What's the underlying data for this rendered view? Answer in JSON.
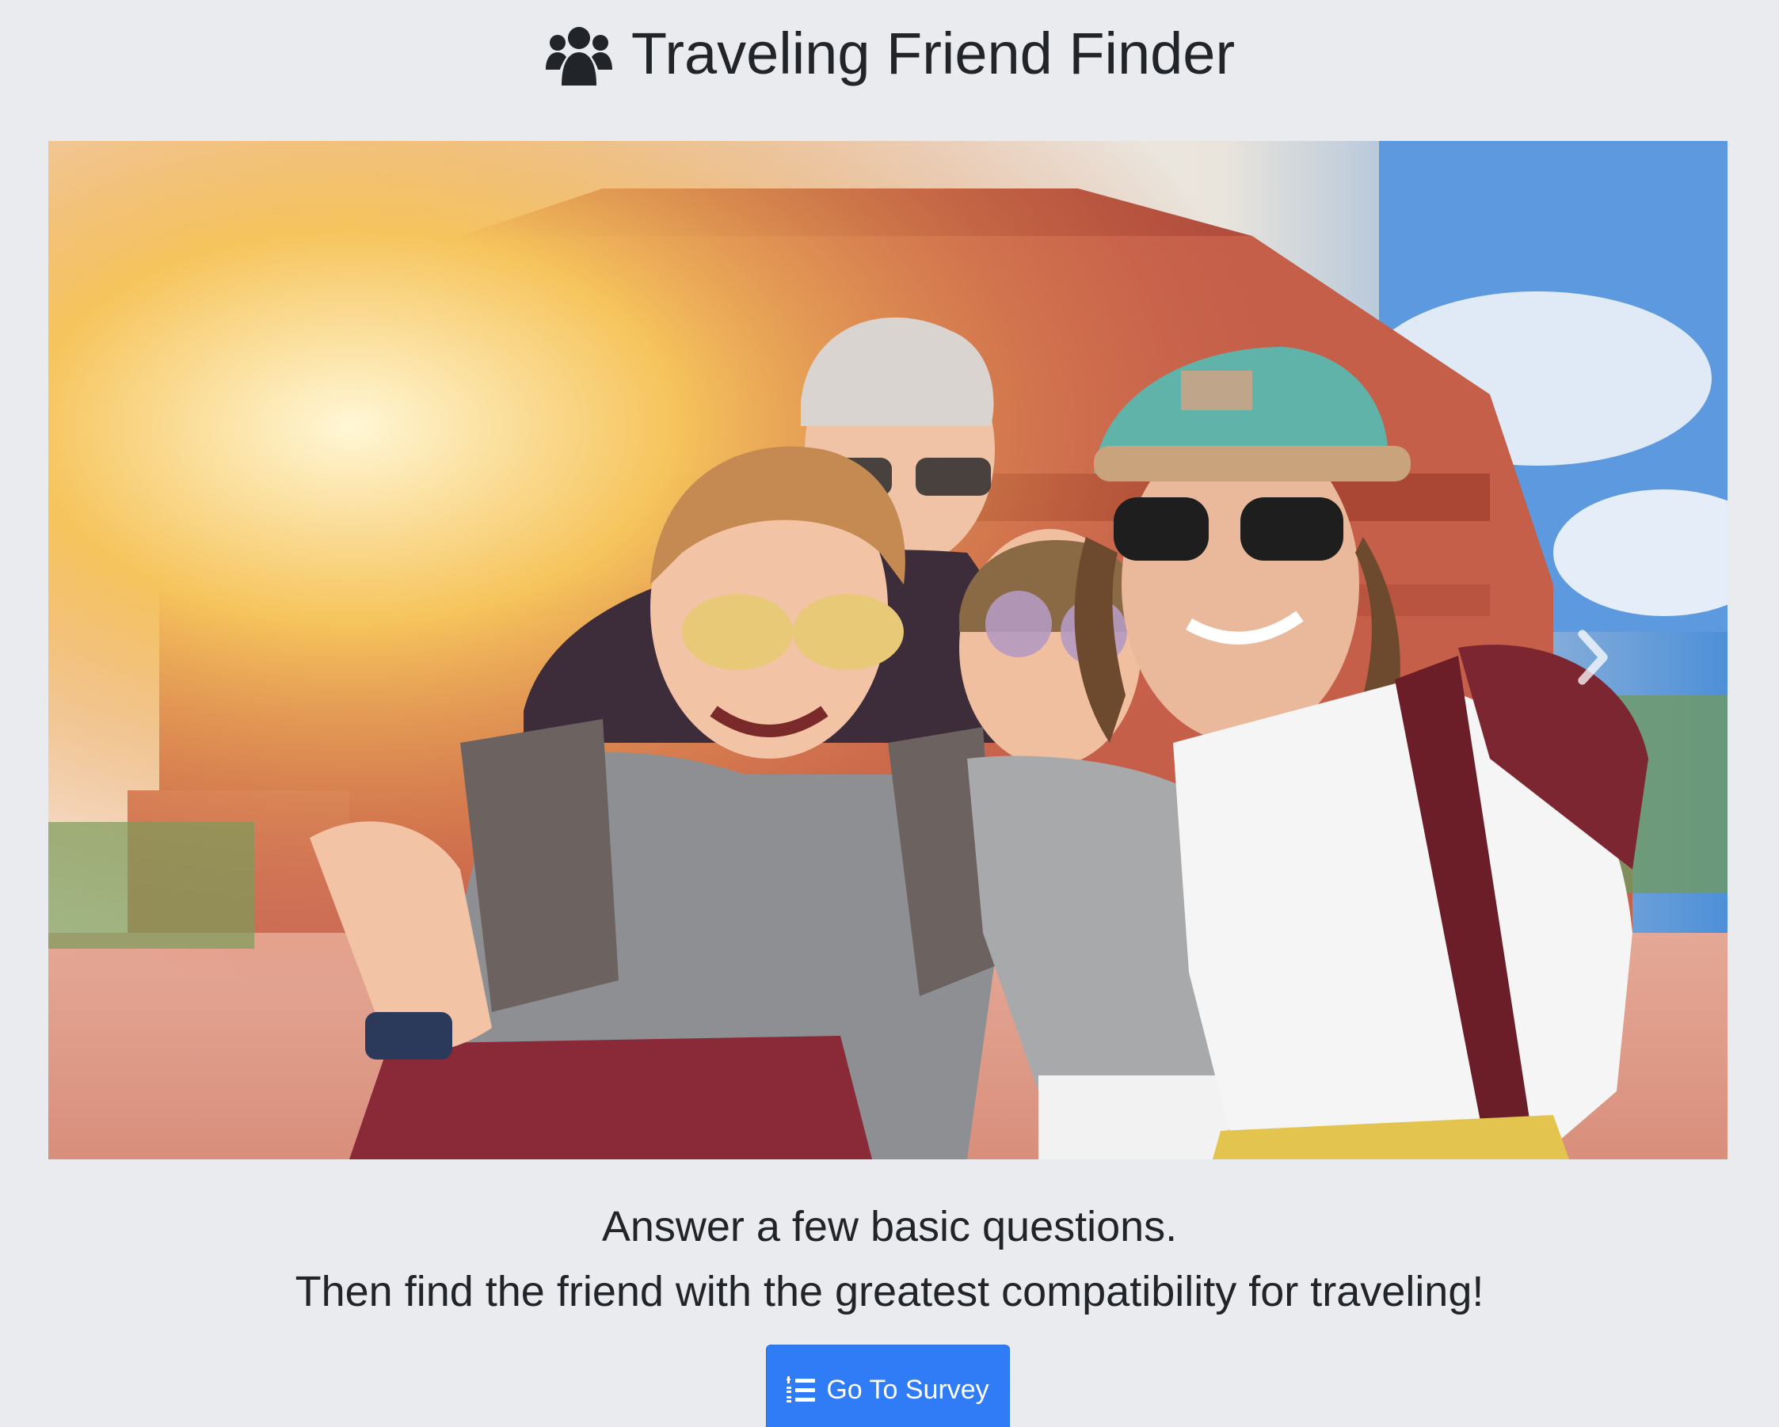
{
  "header": {
    "icon": "users-icon",
    "title": "Traveling Friend Finder"
  },
  "hero": {
    "image": "group-of-friends-travel-photo",
    "next_control_icon": "chevron-right-icon"
  },
  "intro": {
    "line1": "Answer a few basic questions.",
    "line2": "Then find the friend with the greatest compatibility for traveling!"
  },
  "survey_button": {
    "icon": "list-ol-icon",
    "label": "Go To Survey",
    "color": "#2f7cf6"
  },
  "colors": {
    "background": "#e9ebef",
    "text": "#212529"
  }
}
